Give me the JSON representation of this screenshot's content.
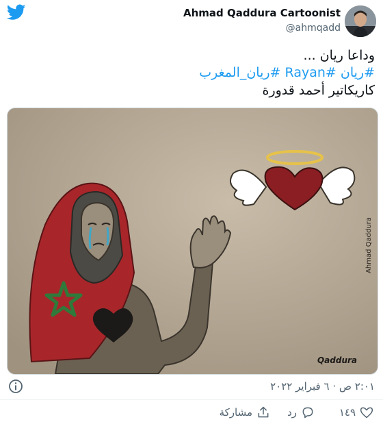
{
  "header": {
    "display_name": "Ahmad Qaddura Cartoonist",
    "handle": "@ahmqadd",
    "logo_icon": "twitter-bird-icon",
    "brand_color": "#1d9bf0"
  },
  "tweet": {
    "line1": "وداعا ريان ...",
    "hashtag_rayyan": "#ريان",
    "hashtag_rayan": "#Rayan",
    "hashtag_morocco": "#ريان_المغرب",
    "line3": "كاريكاتير أحمد قدورة",
    "link_color": "#1d9bf0"
  },
  "media": {
    "artist_signature": "Ahmad Qaddura",
    "signature_logo": "Qaddura"
  },
  "meta": {
    "timestamp": "٢:٠١ ص · ٦ فبراير ٢٠٢٢",
    "info_icon": "info-icon"
  },
  "actions": {
    "like_count": "١٤٩",
    "reply_label": "رد",
    "share_label": "مشاركة"
  }
}
